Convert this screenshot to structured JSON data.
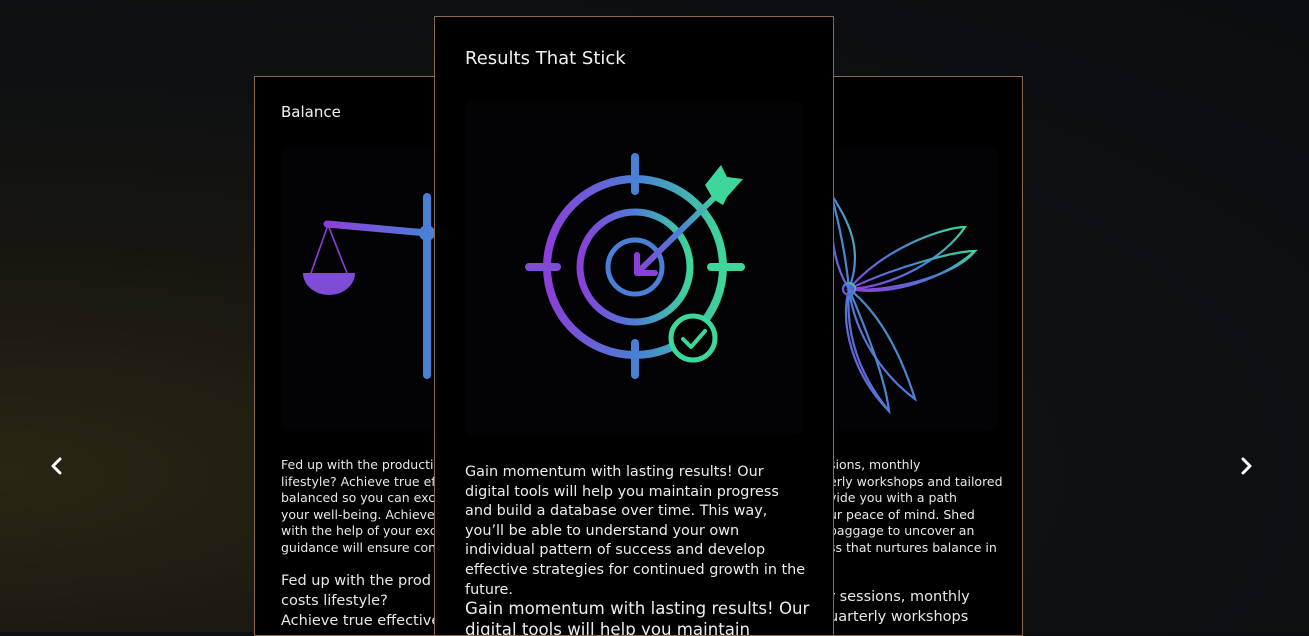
{
  "carousel": {
    "prev_icon": "chevron-left-icon",
    "next_icon": "chevron-right-icon",
    "left_card": {
      "title": "Balance",
      "icon": "scale-icon",
      "small_lines": [
        "Fed up with the productiv",
        "lifestyle? Achieve true effe",
        "balanced so you can excel",
        "your well-being. Achieve lo",
        "with the help of your exclu",
        "guidance will ensure cons"
      ],
      "large_lines": [
        "Fed up with the prod",
        "costs lifestyle?",
        "Achieve true effective"
      ]
    },
    "center_card": {
      "title": "Results That Stick",
      "icon": "target-arrow-icon",
      "body": "Gain momentum with lasting results! Our digital tools will help you maintain progress and build a database over time. This way, you’ll be able to understand your own individual pattern of success and develop effective strategies for continued growth in the future.",
      "large_text": "Gain momentum with lasting results! Our digital tools will help you maintain"
    },
    "right_card": {
      "icon": "lotus-icon",
      "small_lines": [
        "sions, monthly",
        "erly workshops and tailored",
        "vide you with a path",
        "ur peace of mind. Shed",
        " baggage to uncover an",
        "ss that nurtures balance in"
      ],
      "large_lines": [
        "r sessions, monthly",
        "uarterly workshops"
      ]
    }
  },
  "colors": {
    "card_border": "#8a6a4e",
    "gradient_purple": "#8b3fd9",
    "gradient_blue": "#4a7fd6",
    "gradient_green": "#3fd69a"
  }
}
